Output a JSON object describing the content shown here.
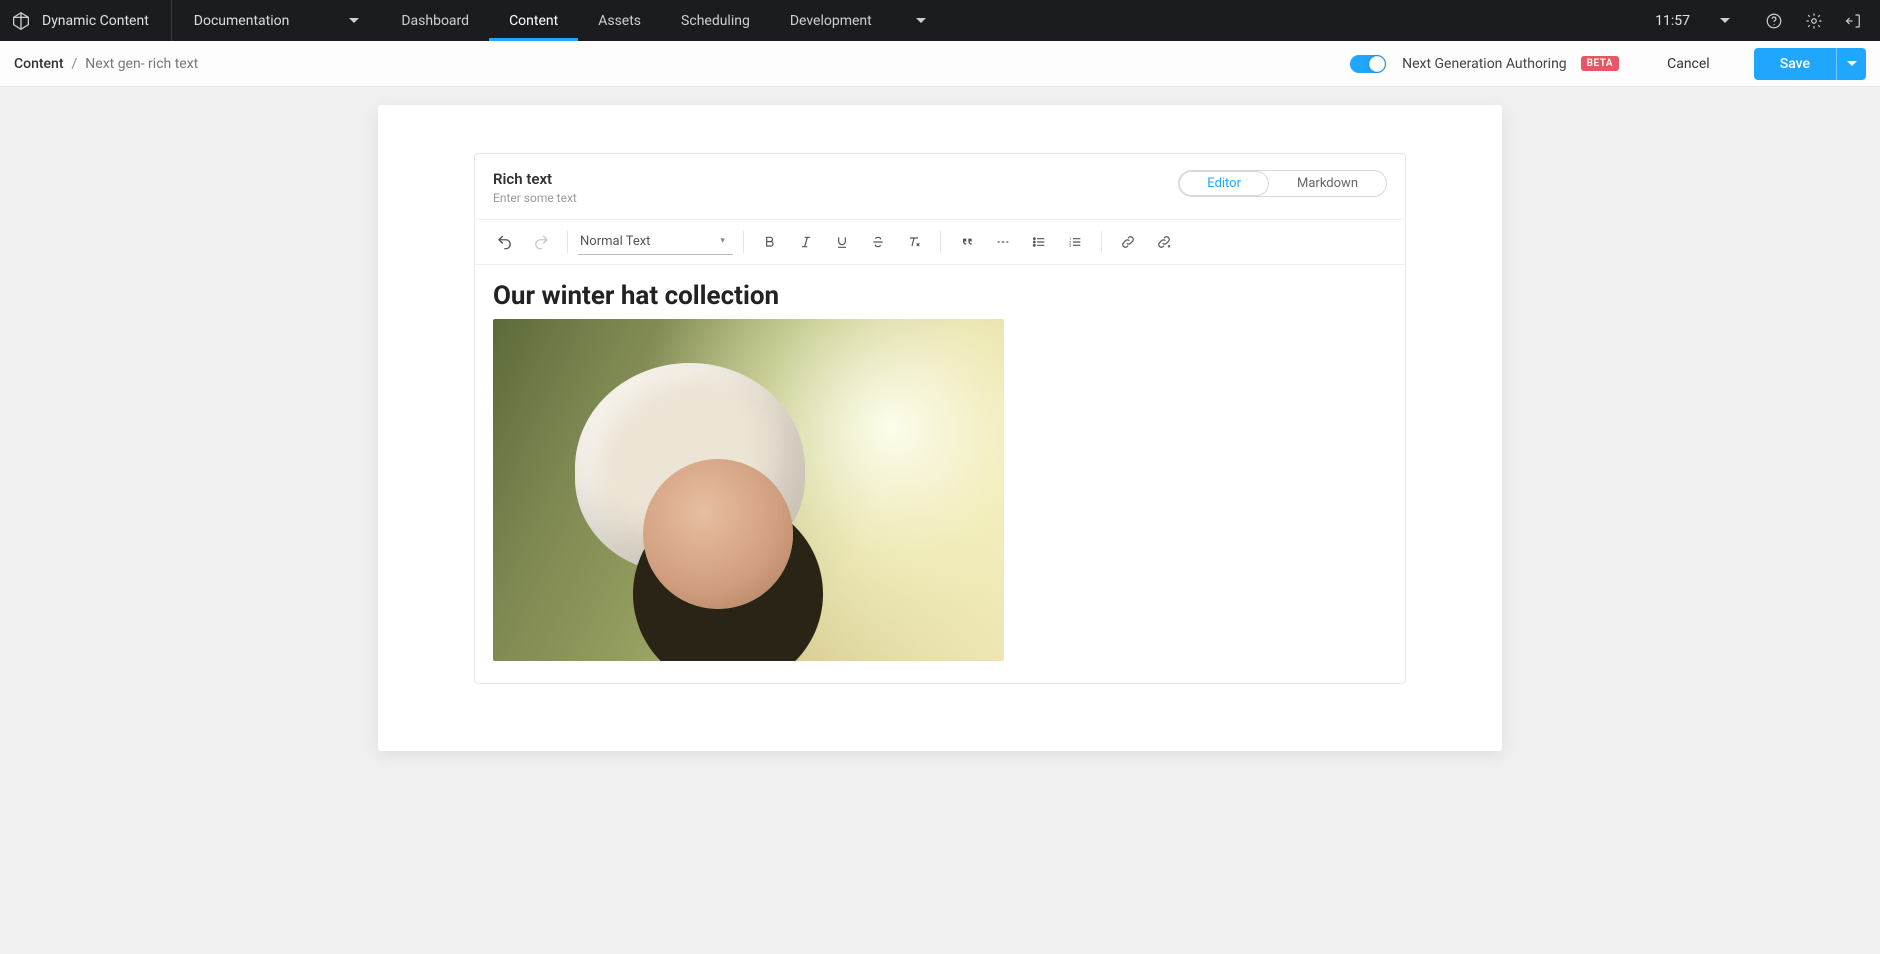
{
  "brand": {
    "name": "Dynamic Content"
  },
  "workspace_switcher": {
    "label": "Documentation"
  },
  "nav": {
    "items": [
      {
        "label": "Dashboard",
        "active": false
      },
      {
        "label": "Content",
        "active": true
      },
      {
        "label": "Assets",
        "active": false
      },
      {
        "label": "Scheduling",
        "active": false
      },
      {
        "label": "Development",
        "active": false
      }
    ]
  },
  "clock": {
    "time": "11:57"
  },
  "breadcrumb": {
    "root": "Content",
    "sep": "/",
    "current": "Next gen- rich text"
  },
  "authoring_toggle": {
    "label": "Next Generation Authoring",
    "badge": "BETA",
    "on": true
  },
  "actions": {
    "cancel": "Cancel",
    "save": "Save"
  },
  "editor": {
    "title": "Rich text",
    "subtitle": "Enter some text",
    "modes": {
      "editor": "Editor",
      "markdown": "Markdown",
      "active": "editor"
    },
    "style_select": "Normal Text",
    "content_heading": "Our winter hat collection",
    "image_alt": "Woman wearing a cream knit beanie outdoors in warm autumn light"
  }
}
